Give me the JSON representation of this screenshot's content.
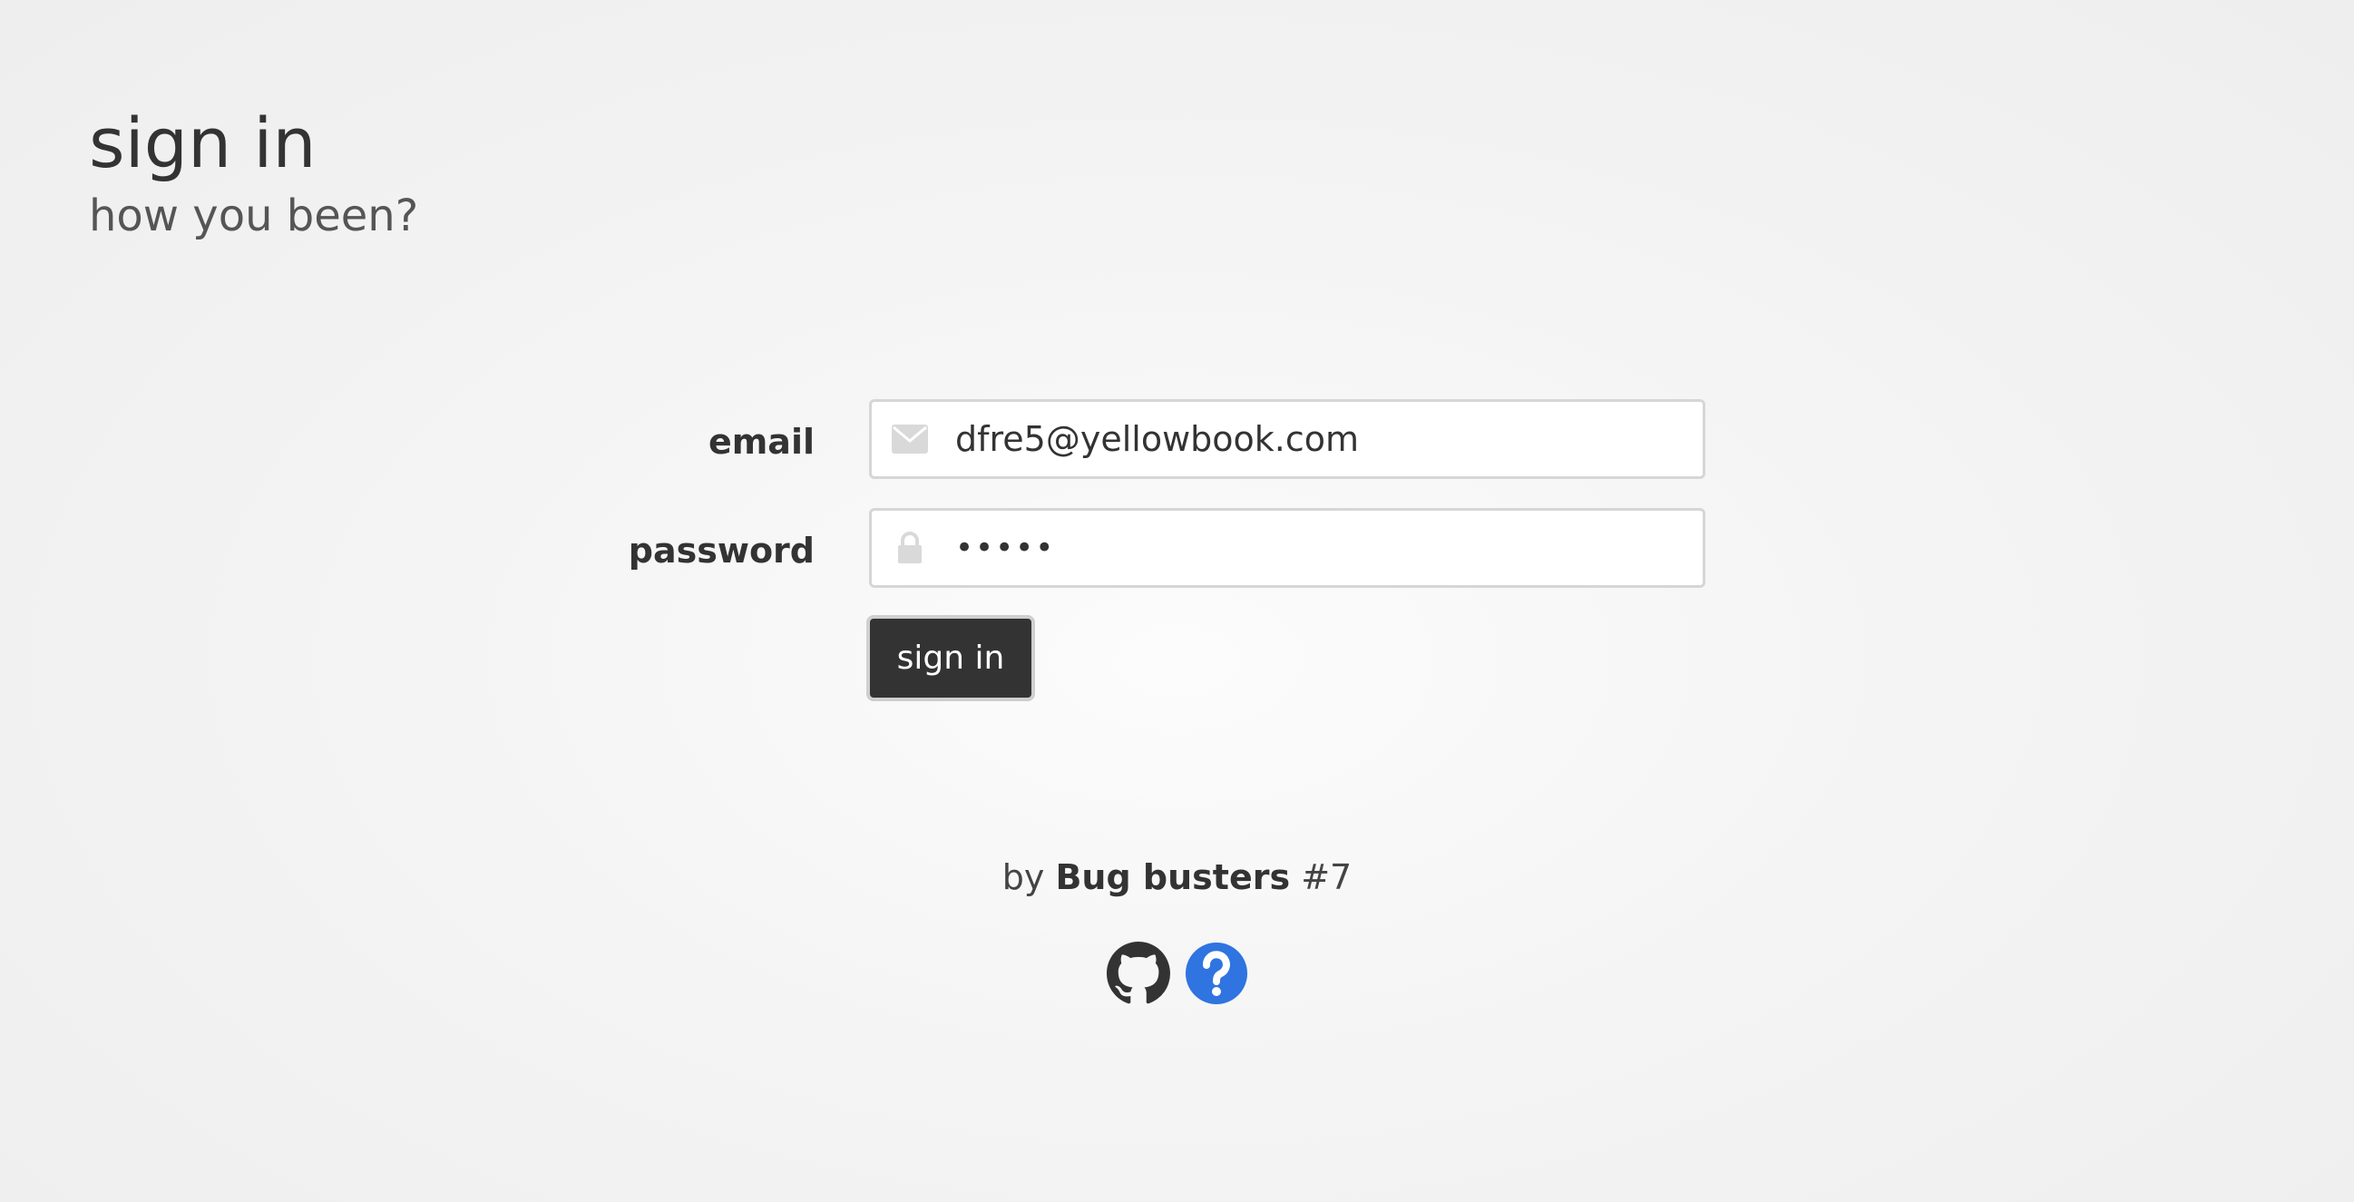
{
  "header": {
    "title": "sign in",
    "subtitle": "how you been?"
  },
  "form": {
    "email": {
      "label": "email",
      "value": "dfre5@yellowbook.com",
      "icon": "envelope-icon"
    },
    "password": {
      "label": "password",
      "value": "•••••",
      "icon": "lock-icon"
    },
    "submit_label": "sign in"
  },
  "footer": {
    "by": "by",
    "team": "Bug busters",
    "number": "#7",
    "icons": [
      "github-icon",
      "help-icon"
    ]
  },
  "colors": {
    "button_bg": "#333333",
    "help_icon": "#2f74e0",
    "github_icon": "#333333"
  }
}
